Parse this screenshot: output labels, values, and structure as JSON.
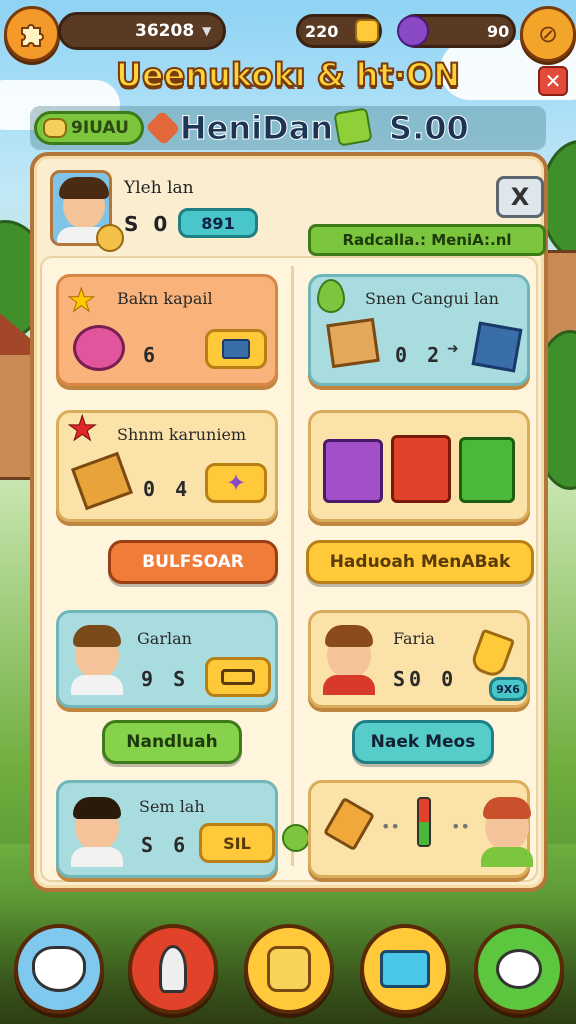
{
  "topbar": {
    "coins_value": "36208",
    "gems_value": "220",
    "potion_value": "90"
  },
  "title": "Ueenukokı & ht∙ON",
  "subbar": {
    "pill_label": "9IUAU",
    "heading": "HeniDan",
    "value": "S.00"
  },
  "profile": {
    "name": "Yleh lan",
    "amount": "S 0",
    "teal_value": "891",
    "banner": "Radcalla.: MeniA:.nl",
    "close_label": "X"
  },
  "cards": [
    {
      "title": "Bakn kapail",
      "value": "6"
    },
    {
      "title": "Snen Cangui lan",
      "value": "0 2"
    },
    {
      "title": "Shnm karuniem",
      "value": "0 4"
    },
    {
      "title": "",
      "value": ""
    },
    {
      "title": "Garlan",
      "value": "9 S",
      "name": "Garlan"
    },
    {
      "title": "Faria",
      "value": "S0 0",
      "badge": "9X6"
    },
    {
      "title": "Sem lah",
      "value": "S 6",
      "btn": "SIL"
    }
  ],
  "buttons": {
    "bulfsoar": "BULFSOAR",
    "haduoah": "Haduoah MenABak",
    "nandluah": "Nandluah",
    "naek": "Naek Meos"
  },
  "colors": {
    "accent": "#ffc93a",
    "panel": "#fbeed0",
    "title": "#ffd23a"
  }
}
